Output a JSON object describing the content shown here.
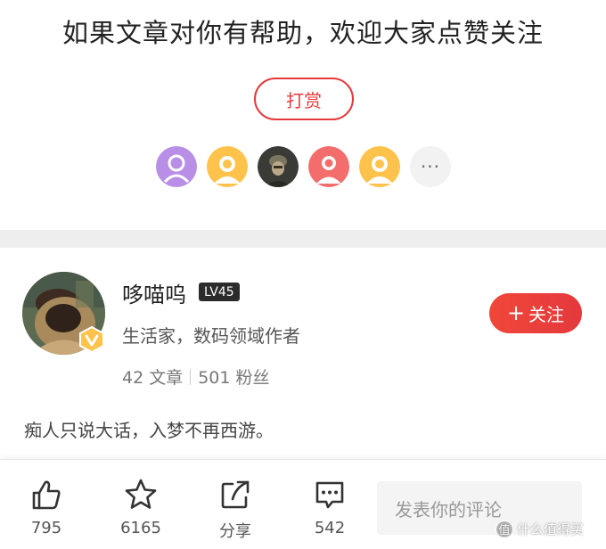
{
  "cta": {
    "title": "如果文章对你有帮助，欢迎大家点赞关注"
  },
  "tip": {
    "label": "打赏",
    "more": "···"
  },
  "tippers": [
    {
      "icon": "default-avatar-icon",
      "color": "#b88ee6"
    },
    {
      "icon": "default-avatar-icon",
      "color": "#ffc24a"
    },
    {
      "icon": "photo-avatar",
      "color": "#3a3a36"
    },
    {
      "icon": "default-avatar-icon",
      "color": "#f36d6d"
    },
    {
      "icon": "default-avatar-icon",
      "color": "#ffc24a"
    }
  ],
  "author": {
    "name": "哆喵呜",
    "level": "LV45",
    "title": "生活家，数码领域作者",
    "articles": "42 文章",
    "fans": "501 粉丝",
    "follow_label": "关注",
    "bio": "痴人只说大话，入梦不再西游。"
  },
  "actions": {
    "like": "795",
    "favorite": "6165",
    "share": "分享",
    "comments": "542"
  },
  "comment": {
    "placeholder": "发表你的评论"
  },
  "watermark": {
    "logo": "值",
    "text": "什么值得买"
  },
  "colors": {
    "accent": "#e4393c",
    "badge_bg": "#2b2b2b",
    "separator": "#eeeeee"
  }
}
